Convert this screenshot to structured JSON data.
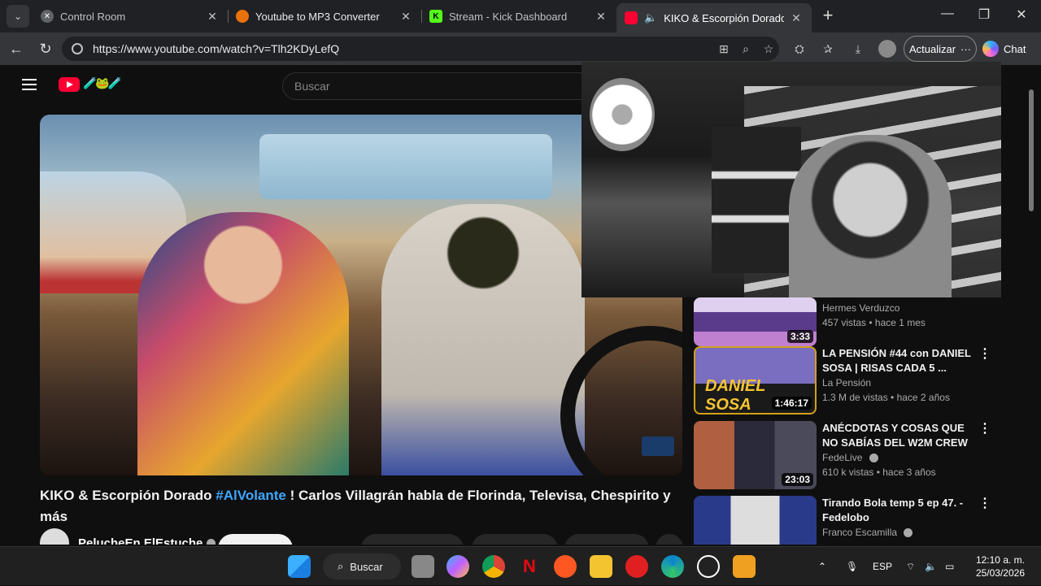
{
  "browser": {
    "tabs": [
      {
        "title": "Control Room",
        "favicon": "settings-favicon",
        "color": "#5f6368"
      },
      {
        "title": "Youtube to MP3 Converter",
        "favicon": "converter-favicon",
        "color": "#e8710a"
      },
      {
        "title": "Stream - Kick Dashboard",
        "favicon": "kick-favicon",
        "color": "#53fc18"
      },
      {
        "title": "KIKO & Escorpión Dorado #Al",
        "favicon": "youtube-favicon",
        "color": "#ff0033"
      }
    ],
    "url": "https://www.youtube.com/watch?v=Tlh2KDyLefQ",
    "update_label": "Actualizar",
    "chat_label": "Chat"
  },
  "youtube": {
    "search_placeholder": "Buscar",
    "video": {
      "title_pre": "KIKO & Escorpión Dorado ",
      "title_hashtag": "#AlVolante",
      "title_post": " ! Carlos Villagrán habla de Florinda, Televisa, Chespirito y más",
      "channel": "PelucheEn ElEstuche"
    },
    "recommendations": [
      {
        "title": "",
        "channel": "Hermes Verduzco",
        "meta": "457 vistas • hace 1 mes",
        "duration": "3:33",
        "verified": false
      },
      {
        "title": "LA PENSIÓN #44 con DANIEL SOSA | RISAS CADA 5 ...",
        "channel": "La Pensión",
        "meta": "1.3 M de vistas • hace 2 años",
        "duration": "1:46:17",
        "verified": false
      },
      {
        "title": "ANÉCDOTAS Y COSAS QUE NO SABÍAS DEL W2M CREW",
        "channel": "FedeLive",
        "meta": "610 k vistas • hace 3 años",
        "duration": "23:03",
        "verified": true
      },
      {
        "title": "Tirando Bola temp 5 ep 47. - Fedelobo",
        "channel": "Franco Escamilla",
        "meta": "",
        "duration": "",
        "verified": true
      }
    ],
    "thumb_texts": [
      "DANIEL SOSA"
    ]
  },
  "taskbar": {
    "search_label": "Buscar",
    "language": "ESP",
    "time": "12:10 a. m.",
    "date": "25/03/2026"
  }
}
